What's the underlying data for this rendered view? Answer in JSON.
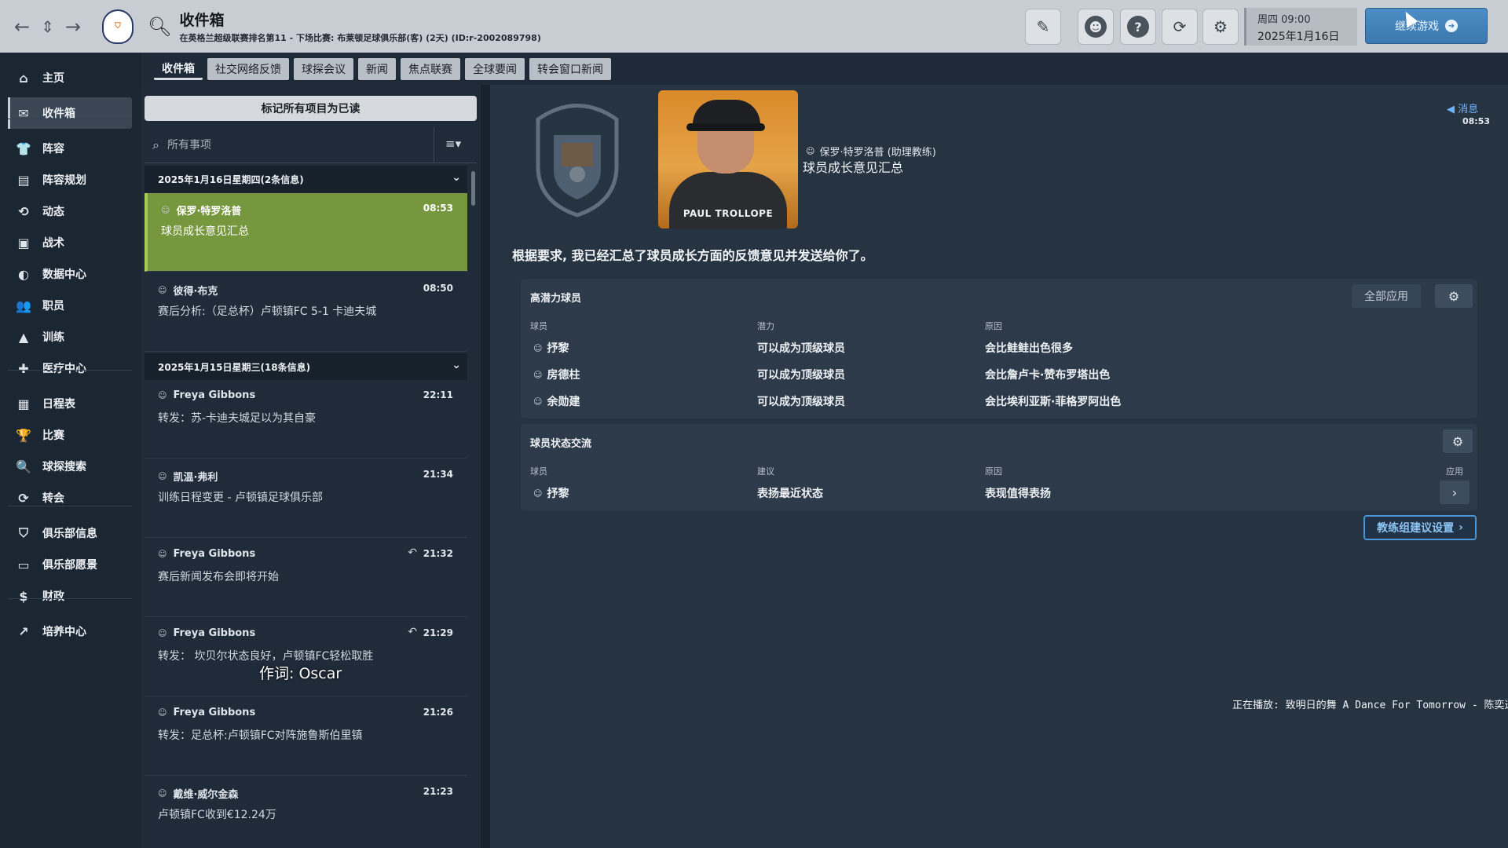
{
  "topbar": {
    "back_icon": "←",
    "updown_icon": "⇕",
    "forward_icon": "→",
    "title": "收件箱",
    "subtitle": "在英格兰超级联赛排名第11 - 下场比赛: 布莱顿足球俱乐部(客) (2天) (ID:r-2002089798)",
    "date_weekday_time": "周四 09:00",
    "date_full": "2025年1月16日",
    "continue_label": "继续游戏",
    "icons": [
      "pencil-icon",
      "globe-icon",
      "help-icon",
      "refresh-icon",
      "gear-icon"
    ]
  },
  "sidebar": {
    "items": [
      {
        "label": "主页",
        "icon": "⌂"
      },
      {
        "label": "收件箱",
        "icon": "✉"
      },
      {
        "label": "阵容",
        "icon": "👕"
      },
      {
        "label": "阵容规划",
        "icon": "▤"
      },
      {
        "label": "动态",
        "icon": "⟲"
      },
      {
        "label": "战术",
        "icon": "▣"
      },
      {
        "label": "数据中心",
        "icon": "◐"
      },
      {
        "label": "职员",
        "icon": "👥"
      },
      {
        "label": "训练",
        "icon": "▲"
      },
      {
        "label": "医疗中心",
        "icon": "✚"
      },
      {
        "label": "日程表",
        "icon": "▦"
      },
      {
        "label": "比赛",
        "icon": "🏆"
      },
      {
        "label": "球探搜索",
        "icon": "🔍"
      },
      {
        "label": "转会",
        "icon": "⟳"
      },
      {
        "label": "俱乐部信息",
        "icon": "⛉"
      },
      {
        "label": "俱乐部愿景",
        "icon": "▭"
      },
      {
        "label": "财政",
        "icon": "$"
      },
      {
        "label": "培养中心",
        "icon": "↗"
      }
    ]
  },
  "tabs": [
    "收件箱",
    "社交网络反馈",
    "球探会议",
    "新闻",
    "焦点联赛",
    "全球要闻",
    "转会窗口新闻"
  ],
  "inbox": {
    "mark_all_label": "标记所有项目为已读",
    "search_placeholder": "所有事项",
    "filter_icon": "≡▾",
    "group1_header": "2025年1月16日星期四(2条信息)",
    "group2_header": "2025年1月15日星期三(18条信息)",
    "messages": [
      {
        "sender": "保罗·特罗洛普",
        "time": "08:53",
        "subject": "球员成长意见汇总"
      },
      {
        "sender": "彼得·布克",
        "time": "08:50",
        "subject": "赛后分析:（足总杯）卢顿镇FC 5-1 卡迪夫城"
      },
      {
        "sender": "Freya Gibbons",
        "time": "22:11",
        "subject": "转发：苏-卡迪夫城足以为其自豪"
      },
      {
        "sender": "凯温·弗利",
        "time": "21:34",
        "subject": "训练日程变更 - 卢顿镇足球俱乐部"
      },
      {
        "sender": "Freya Gibbons",
        "time": "21:32",
        "subject": "赛后新闻发布会即将开始"
      },
      {
        "sender": "Freya Gibbons",
        "time": "21:29",
        "subject": "转发：  坎贝尔状态良好，卢顿镇FC轻松取胜"
      },
      {
        "sender": "Freya Gibbons",
        "time": "21:26",
        "subject": "转发：足总杯:卢顿镇FC对阵施鲁斯伯里镇"
      },
      {
        "sender": "戴维·威尔金森",
        "time": "21:23",
        "subject": "卢顿镇FC收到€12.24万"
      }
    ]
  },
  "lyric": "作词: Oscar",
  "reader": {
    "from": "保罗·特罗洛普 (助理教练)",
    "subject": "球员成长意见汇总",
    "photo_name": "PAUL TROLLOPE",
    "corner_label": "消息",
    "corner_time": "08:53",
    "intro": "根据要求, 我已经汇总了球员成长方面的反馈意见并发送给你了。",
    "high_potential": {
      "title": "高潜力球员",
      "apply_all": "全部应用",
      "col_player": "球员",
      "col_potential": "潜力",
      "col_reason": "原因",
      "rows": [
        {
          "player": "抒黎",
          "potential": "可以成为顶级球员",
          "reason": "会比鲑鲑出色很多"
        },
        {
          "player": "房德柱",
          "potential": "可以成为顶级球员",
          "reason": "会比詹卢卡·赞布罗塔出色"
        },
        {
          "player": "余勋建",
          "potential": "可以成为顶级球员",
          "reason": "会比埃利亚斯·菲格罗阿出色"
        }
      ]
    },
    "status_exchange": {
      "title": "球员状态交流",
      "col_player": "球员",
      "col_advice": "建议",
      "col_reason": "原因",
      "col_apply": "应用",
      "rows": [
        {
          "player": "抒黎",
          "advice": "表扬最近状态",
          "reason": "表现值得表扬"
        }
      ]
    },
    "coach_button": "教练组建议设置"
  },
  "now_playing": "正在播放: 致明日的舞 A Dance For Tomorrow - 陈奕迅",
  "colors": {
    "accent_blue": "#4b94d6",
    "selected_green": "#77973e",
    "topbar_bg": "#c9ced4"
  }
}
